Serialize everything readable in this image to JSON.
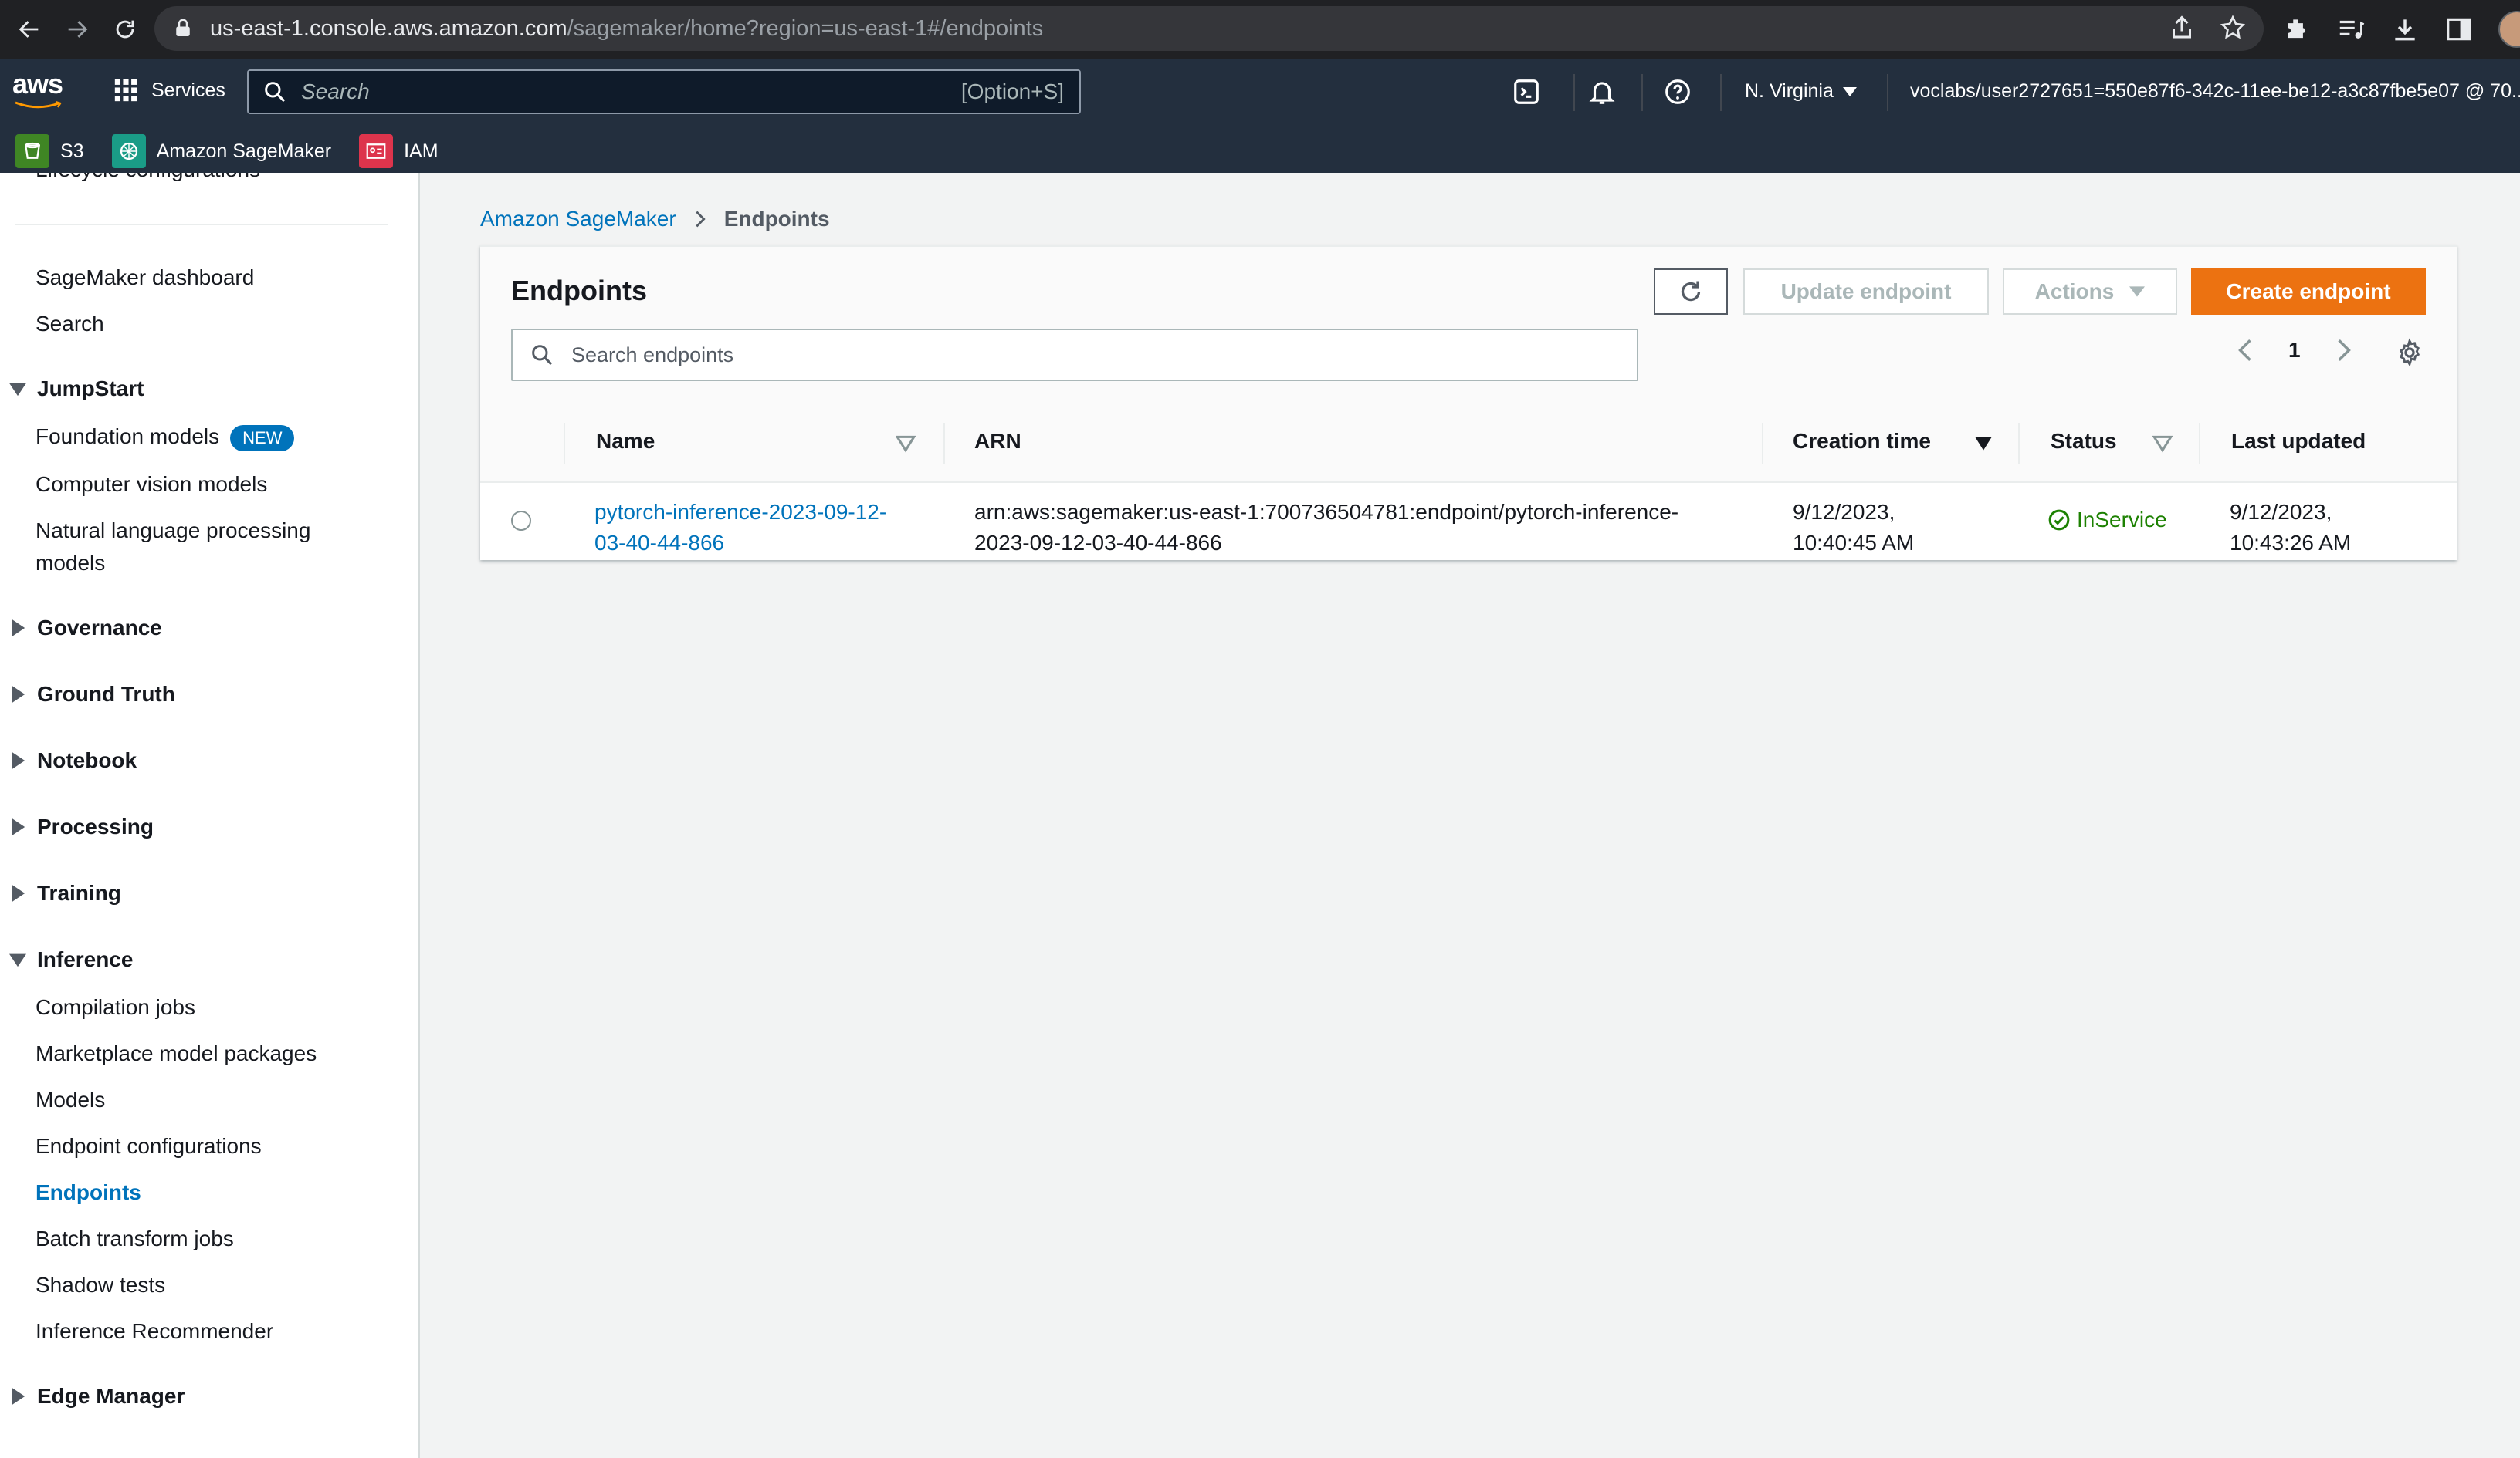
{
  "browser": {
    "url_host": "us-east-1.console.aws.amazon.com",
    "url_path": "/sagemaker/home?region=us-east-1#/endpoints"
  },
  "aws_nav": {
    "logo": "aws",
    "services_label": "Services",
    "search_placeholder": "Search",
    "search_shortcut": "[Option+S]",
    "region": "N. Virginia",
    "account": "voclabs/user2727651=550e87f6-342c-11ee-be12-a3c87fbe5e07 @ 70..."
  },
  "favorites": [
    {
      "label": "S3",
      "color": "#3f8624"
    },
    {
      "label": "Amazon SageMaker",
      "color": "#1a9c87"
    },
    {
      "label": "IAM",
      "color": "#dd344c"
    }
  ],
  "sidebar": {
    "cut_item": "Lifecycle configurations",
    "top_items": [
      "SageMaker dashboard",
      "Search"
    ],
    "jumpstart": {
      "label": "JumpStart",
      "items": [
        "Foundation models",
        "Computer vision models",
        "Natural language processing",
        "models"
      ],
      "badge": "NEW"
    },
    "collapsed_sections": [
      "Governance",
      "Ground Truth",
      "Notebook",
      "Processing",
      "Training"
    ],
    "inference": {
      "label": "Inference",
      "items": [
        "Compilation jobs",
        "Marketplace model packages",
        "Models",
        "Endpoint configurations",
        "Endpoints",
        "Batch transform jobs",
        "Shadow tests",
        "Inference Recommender"
      ],
      "active": "Endpoints"
    },
    "edge_manager": "Edge Manager"
  },
  "breadcrumb": {
    "root": "Amazon SageMaker",
    "current": "Endpoints"
  },
  "panel": {
    "title": "Endpoints",
    "update_button": "Update endpoint",
    "actions_button": "Actions",
    "create_button": "Create endpoint",
    "search_placeholder": "Search endpoints",
    "page_number": "1"
  },
  "table": {
    "columns": [
      "Name",
      "ARN",
      "Creation time",
      "Status",
      "Last updated"
    ],
    "rows": [
      {
        "name_line1": "pytorch-inference-2023-09-12-",
        "name_line2": "03-40-44-866",
        "arn_line1": "arn:aws:sagemaker:us-east-1:700736504781:endpoint/pytorch-inference-",
        "arn_line2": "2023-09-12-03-40-44-866",
        "created_line1": "9/12/2023,",
        "created_line2": "10:40:45 AM",
        "status": "InService",
        "updated_line1": "9/12/2023,",
        "updated_line2": "10:43:26 AM"
      }
    ]
  },
  "colors": {
    "accent": "#0073bb",
    "primary_button": "#ec7211",
    "success": "#1d8102",
    "nav_bg": "#232f3e"
  }
}
